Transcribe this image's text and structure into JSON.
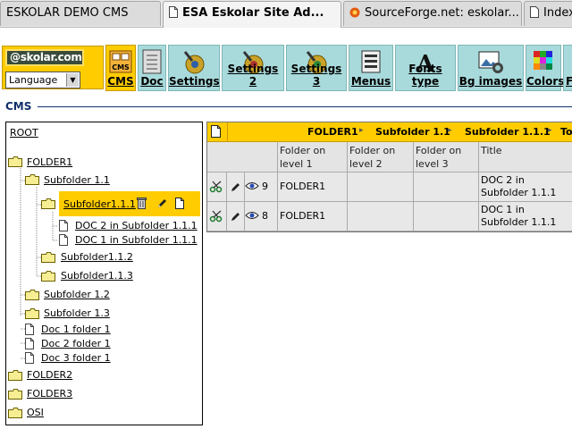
{
  "browser": {
    "tabs": [
      {
        "label": "ESKOLAR DEMO CMS",
        "active": false
      },
      {
        "label": "ESA Eskolar Site Ad...",
        "active": true
      },
      {
        "label": "SourceForge.net: eskolar...",
        "active": false
      },
      {
        "label": "Index",
        "active": false
      }
    ]
  },
  "toolbar": {
    "logo_text": "@skolar.com",
    "language_select": "Language",
    "buttons": [
      {
        "label": "CMS",
        "icon": "cms-icon",
        "active": true
      },
      {
        "label": "Doc",
        "icon": "doc-icon",
        "active": false
      },
      {
        "label": "Settings",
        "icon": "settings-icon",
        "active": false
      },
      {
        "label": "Settings 2",
        "icon": "settings-icon",
        "active": false
      },
      {
        "label": "Settings 3",
        "icon": "settings-icon",
        "active": false
      },
      {
        "label": "Menus",
        "icon": "menus-icon",
        "active": false
      },
      {
        "label": "Fonts type",
        "icon": "fonts-icon",
        "active": false
      },
      {
        "label": "Bg images",
        "icon": "image-icon",
        "active": false
      },
      {
        "label": "Colors",
        "icon": "colors-icon",
        "active": false
      },
      {
        "label": "F",
        "icon": "fonts-icon",
        "active": false
      }
    ]
  },
  "section_title": "CMS",
  "tree": {
    "root": "ROOT",
    "items": [
      {
        "label": "FOLDER1",
        "kind": "folder"
      },
      {
        "label": "Subfolder 1.1",
        "kind": "folder"
      },
      {
        "label": "Subfolder1.1.1",
        "kind": "folder",
        "selected": true
      },
      {
        "label": "DOC 2 in Subfolder 1.1.1",
        "kind": "doc"
      },
      {
        "label": "DOC 1 in Subfolder 1.1.1",
        "kind": "doc"
      },
      {
        "label": "Subfolder1.1.2",
        "kind": "folder"
      },
      {
        "label": "Subfolder1.1.3",
        "kind": "folder"
      },
      {
        "label": "Subfolder 1.2",
        "kind": "folder"
      },
      {
        "label": "Subfolder 1.3",
        "kind": "folder"
      },
      {
        "label": "Doc 1 folder 1",
        "kind": "doc"
      },
      {
        "label": "Doc 2 folder 1",
        "kind": "doc"
      },
      {
        "label": "Doc 3 folder 1",
        "kind": "doc"
      },
      {
        "label": "FOLDER2",
        "kind": "folder"
      },
      {
        "label": "FOLDER3",
        "kind": "folder"
      },
      {
        "label": "OSI",
        "kind": "folder"
      }
    ]
  },
  "table": {
    "breadcrumb": [
      "FOLDER1",
      "Subfolder 1.1",
      "Subfolder 1.1.1",
      "To"
    ],
    "headers": [
      "Folder on level 1",
      "Folder on level 2",
      "Folder on level 3",
      "Title"
    ],
    "rows": [
      {
        "id": "9",
        "level1": "FOLDER1",
        "level2": "",
        "level3": "",
        "title": "DOC 2 in Subfolder 1.1.1"
      },
      {
        "id": "8",
        "level1": "FOLDER1",
        "level2": "",
        "level3": "",
        "title": "DOC 1 in Subfolder 1.1.1"
      }
    ]
  },
  "colors": {
    "accent_yellow": "#ffcc00",
    "toolbar_teal": "#a8dadc",
    "title_navy": "#10306a"
  }
}
